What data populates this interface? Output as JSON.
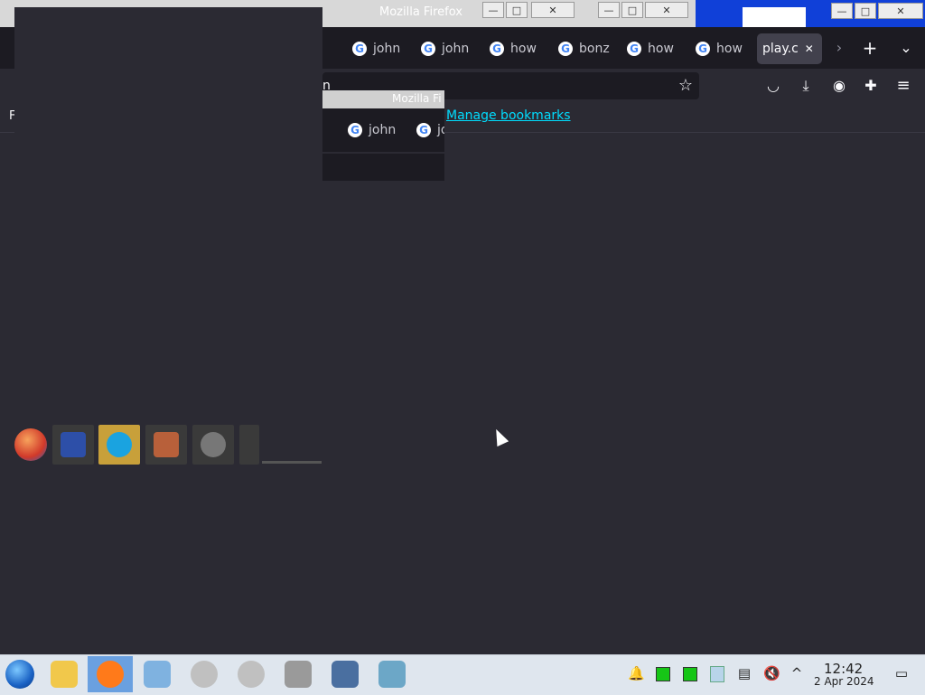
{
  "window": {
    "title": "Mozilla Firefox",
    "buttons": {
      "minimize": "—",
      "maximize": "□",
      "close": "✕"
    }
  },
  "tabs": [
    {
      "label": "how"
    },
    {
      "label": "john"
    },
    {
      "label": "john"
    },
    {
      "label": "how"
    },
    {
      "label": "bonz"
    },
    {
      "label": "how"
    },
    {
      "label": "how"
    }
  ],
  "active_tab": {
    "label": "play.c",
    "close": "✕"
  },
  "tabbar": {
    "scroll_right": "›",
    "new_tab": "+",
    "list_all": "⌄"
  },
  "navbar": {
    "url_partial": "n",
    "star": "☆",
    "pocket": "◡",
    "downloads": "⤓",
    "account": "◉",
    "extensions": "✚",
    "menu": "≡"
  },
  "bookmarks": {
    "left_partial": "F",
    "manage": "Manage bookmarks"
  },
  "ghost_window": {
    "title": "Mozilla Fi",
    "tabs": [
      {
        "label": "john"
      },
      {
        "label": "jo"
      }
    ]
  },
  "taskbar": {
    "clock": {
      "time": "12:42",
      "date": "2 Apr 2024"
    },
    "tray": {
      "notifications": "🔔",
      "clipboard": "▤",
      "volume": "🔇",
      "expand": "^",
      "desktop": "▭"
    }
  },
  "colors": {
    "accent": "#00ddff",
    "background": "#2b2a33",
    "tabbar": "#1c1b22",
    "taskbar": "#dfe6ee"
  }
}
